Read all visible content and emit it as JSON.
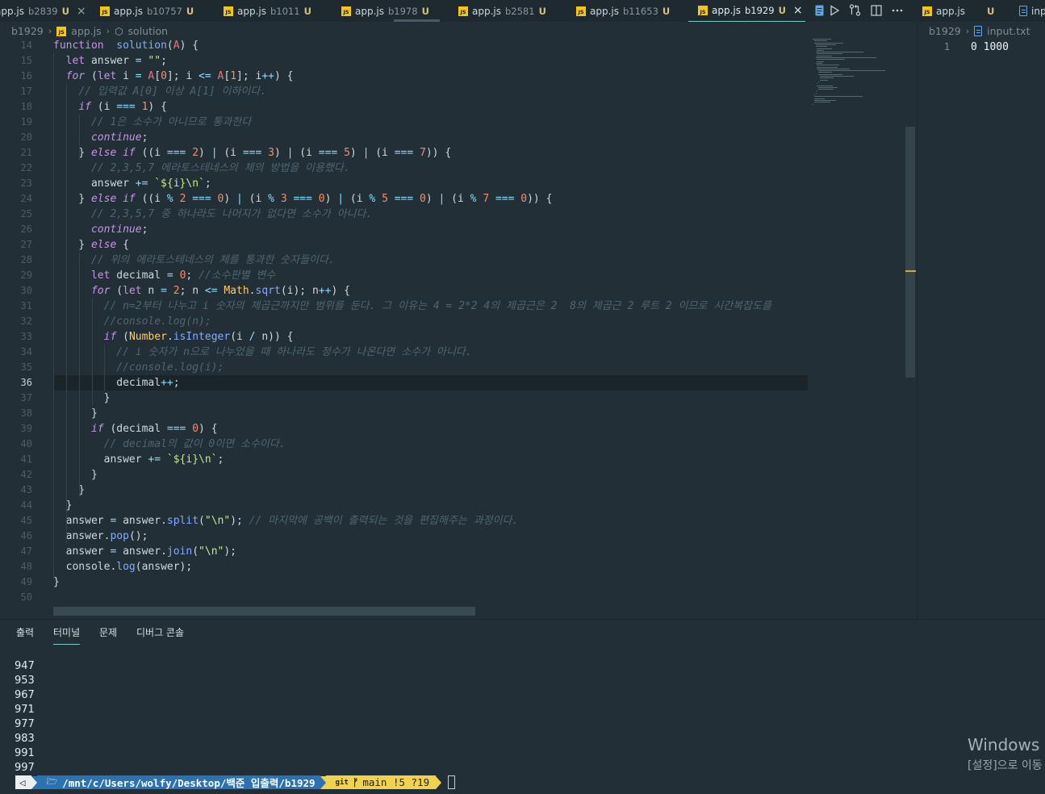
{
  "tabs": [
    {
      "name": "app.js",
      "desc": "b2839",
      "badge": "U",
      "close": "×",
      "active": false
    },
    {
      "name": "app.js",
      "desc": "b10757",
      "badge": "U",
      "active": false
    },
    {
      "name": "app.js",
      "desc": "b1011",
      "badge": "U",
      "active": false
    },
    {
      "name": "app.js",
      "desc": "b1978",
      "badge": "U",
      "active": false
    },
    {
      "name": "app.js",
      "desc": "b2581",
      "badge": "U",
      "active": false
    },
    {
      "name": "app.js",
      "desc": "b11653",
      "badge": "U",
      "active": false
    },
    {
      "name": "app.js",
      "desc": "b1929",
      "badge": "U",
      "close": "×",
      "active": true
    }
  ],
  "right_tabs": [
    {
      "name": "app.js",
      "badge": "U"
    },
    {
      "name": "inp"
    }
  ],
  "toolbar_icons": [
    "open-preview-icon",
    "run-icon",
    "git-compare-icon",
    "split-editor-icon",
    "more-actions-icon"
  ],
  "js_icon_label": "JS",
  "breadcrumb": {
    "folder": "b1929",
    "file": "app.js",
    "symbol": "solution"
  },
  "right_breadcrumb": {
    "folder": "b1929",
    "file": "input.txt"
  },
  "input_file": {
    "line_number": "1",
    "content": "0 1000"
  },
  "editor": {
    "current_line": "36",
    "lines": [
      {
        "n": "14",
        "tokens": [
          [
            "kw",
            "function"
          ],
          [
            "",
            "  "
          ],
          [
            "fn",
            "solution"
          ],
          [
            "",
            "("
          ],
          [
            "par",
            "A"
          ],
          [
            "",
            ") {"
          ]
        ]
      },
      {
        "n": "15",
        "tokens": [
          [
            "",
            "  "
          ],
          [
            "kw",
            "let"
          ],
          [
            "",
            " answer "
          ],
          [
            "op",
            "="
          ],
          [
            "",
            " "
          ],
          [
            "str",
            "\"\""
          ],
          [
            "",
            ";"
          ]
        ]
      },
      {
        "n": "16",
        "tokens": [
          [
            "",
            "  "
          ],
          [
            "kwi",
            "for"
          ],
          [
            "",
            " ("
          ],
          [
            "kw",
            "let"
          ],
          [
            "",
            " i "
          ],
          [
            "op",
            "="
          ],
          [
            "",
            " "
          ],
          [
            "par",
            "A"
          ],
          [
            "",
            "["
          ],
          [
            "num",
            "0"
          ],
          [
            "",
            "]; i "
          ],
          [
            "op",
            "<="
          ],
          [
            "",
            " "
          ],
          [
            "par",
            "A"
          ],
          [
            "",
            "["
          ],
          [
            "num",
            "1"
          ],
          [
            "",
            "]; i"
          ],
          [
            "op",
            "++"
          ],
          [
            "",
            ") {"
          ]
        ]
      },
      {
        "n": "17",
        "tokens": [
          [
            "",
            "    "
          ],
          [
            "cm",
            "// 입력값 A[0] 이상 A[1] 이하이다."
          ]
        ]
      },
      {
        "n": "18",
        "tokens": [
          [
            "",
            "    "
          ],
          [
            "kwi",
            "if"
          ],
          [
            "",
            " (i "
          ],
          [
            "op",
            "==="
          ],
          [
            "",
            " "
          ],
          [
            "num",
            "1"
          ],
          [
            "",
            ") {"
          ]
        ]
      },
      {
        "n": "19",
        "tokens": [
          [
            "",
            "      "
          ],
          [
            "cm",
            "// 1은 소수가 아니므로 통과한다"
          ]
        ]
      },
      {
        "n": "20",
        "tokens": [
          [
            "",
            "      "
          ],
          [
            "kwi",
            "continue"
          ],
          [
            "",
            ";"
          ]
        ]
      },
      {
        "n": "21",
        "tokens": [
          [
            "",
            "    } "
          ],
          [
            "kwi",
            "else if"
          ],
          [
            "",
            " ((i "
          ],
          [
            "op",
            "==="
          ],
          [
            "",
            " "
          ],
          [
            "num",
            "2"
          ],
          [
            "",
            ") "
          ],
          [
            "op",
            "|"
          ],
          [
            "",
            " (i "
          ],
          [
            "op",
            "==="
          ],
          [
            "",
            " "
          ],
          [
            "num",
            "3"
          ],
          [
            "",
            ") "
          ],
          [
            "op",
            "|"
          ],
          [
            "",
            " (i "
          ],
          [
            "op",
            "==="
          ],
          [
            "",
            " "
          ],
          [
            "num",
            "5"
          ],
          [
            "",
            ") "
          ],
          [
            "op",
            "|"
          ],
          [
            "",
            " (i "
          ],
          [
            "op",
            "==="
          ],
          [
            "",
            " "
          ],
          [
            "num",
            "7"
          ],
          [
            "",
            ")) {"
          ]
        ]
      },
      {
        "n": "22",
        "tokens": [
          [
            "",
            "      "
          ],
          [
            "cm",
            "// 2,3,5,7 에라토스테네스의 체의 방법을 이용했다."
          ]
        ]
      },
      {
        "n": "23",
        "tokens": [
          [
            "",
            "      answer "
          ],
          [
            "op",
            "+="
          ],
          [
            "",
            " "
          ],
          [
            "str",
            "`${"
          ],
          [
            "",
            "i"
          ],
          [
            "str",
            "}\\n`"
          ],
          [
            "",
            ";"
          ]
        ]
      },
      {
        "n": "24",
        "tokens": [
          [
            "",
            "    } "
          ],
          [
            "kwi",
            "else if"
          ],
          [
            "",
            " ((i "
          ],
          [
            "op",
            "%"
          ],
          [
            "",
            " "
          ],
          [
            "num",
            "2"
          ],
          [
            "",
            " "
          ],
          [
            "op",
            "==="
          ],
          [
            "",
            " "
          ],
          [
            "num",
            "0"
          ],
          [
            "",
            ") "
          ],
          [
            "op",
            "|"
          ],
          [
            "",
            " (i "
          ],
          [
            "op",
            "%"
          ],
          [
            "",
            " "
          ],
          [
            "num",
            "3"
          ],
          [
            "",
            " "
          ],
          [
            "op",
            "==="
          ],
          [
            "",
            " "
          ],
          [
            "num",
            "0"
          ],
          [
            "",
            ") "
          ],
          [
            "op",
            "|"
          ],
          [
            "",
            " (i "
          ],
          [
            "op",
            "%"
          ],
          [
            "",
            " "
          ],
          [
            "num",
            "5"
          ],
          [
            "",
            " "
          ],
          [
            "op",
            "==="
          ],
          [
            "",
            " "
          ],
          [
            "num",
            "0"
          ],
          [
            "",
            ") "
          ],
          [
            "op",
            "|"
          ],
          [
            "",
            " (i "
          ],
          [
            "op",
            "%"
          ],
          [
            "",
            " "
          ],
          [
            "num",
            "7"
          ],
          [
            "",
            " "
          ],
          [
            "op",
            "==="
          ],
          [
            "",
            " "
          ],
          [
            "num",
            "0"
          ],
          [
            "",
            ")) {"
          ]
        ]
      },
      {
        "n": "25",
        "tokens": [
          [
            "",
            "      "
          ],
          [
            "cm",
            "// 2,3,5,7 중 하나라도 나머지가 없다면 소수가 아니다."
          ]
        ]
      },
      {
        "n": "26",
        "tokens": [
          [
            "",
            "      "
          ],
          [
            "kwi",
            "continue"
          ],
          [
            "",
            ";"
          ]
        ]
      },
      {
        "n": "27",
        "tokens": [
          [
            "",
            "    } "
          ],
          [
            "kwi",
            "else"
          ],
          [
            "",
            " {"
          ]
        ]
      },
      {
        "n": "28",
        "tokens": [
          [
            "",
            "      "
          ],
          [
            "cm",
            "// 위의 에라토스테네스의 체를 통과한 숫자들이다."
          ]
        ]
      },
      {
        "n": "29",
        "tokens": [
          [
            "",
            "      "
          ],
          [
            "kw",
            "let"
          ],
          [
            "",
            " decimal "
          ],
          [
            "op",
            "="
          ],
          [
            "",
            " "
          ],
          [
            "num",
            "0"
          ],
          [
            "",
            "; "
          ],
          [
            "cm",
            "//소수판별 변수"
          ]
        ]
      },
      {
        "n": "30",
        "tokens": [
          [
            "",
            "      "
          ],
          [
            "kwi",
            "for"
          ],
          [
            "",
            " ("
          ],
          [
            "kw",
            "let"
          ],
          [
            "",
            " n "
          ],
          [
            "op",
            "="
          ],
          [
            "",
            " "
          ],
          [
            "num",
            "2"
          ],
          [
            "",
            "; n "
          ],
          [
            "op",
            "<="
          ],
          [
            "",
            " "
          ],
          [
            "cls",
            "Math"
          ],
          [
            "",
            "."
          ],
          [
            "fn",
            "sqrt"
          ],
          [
            "",
            "(i); n"
          ],
          [
            "op",
            "++"
          ],
          [
            "",
            ") {"
          ]
        ]
      },
      {
        "n": "31",
        "tokens": [
          [
            "",
            "        "
          ],
          [
            "cm",
            "// n=2부터 나누고 i 숫자의 제곱근까지만 범위를 둔다. 그 이유는 4 = 2*2 4의 제곱근은 2  8의 제곱근 2 루트 2 이므로 시간복잡도를"
          ]
        ]
      },
      {
        "n": "32",
        "tokens": [
          [
            "",
            "        "
          ],
          [
            "cm",
            "//console.log(n);"
          ]
        ]
      },
      {
        "n": "33",
        "tokens": [
          [
            "",
            "        "
          ],
          [
            "kwi",
            "if"
          ],
          [
            "",
            " ("
          ],
          [
            "cls",
            "Number"
          ],
          [
            "",
            "."
          ],
          [
            "fn",
            "isInteger"
          ],
          [
            "",
            "(i "
          ],
          [
            "op",
            "/"
          ],
          [
            "",
            " n)) {"
          ]
        ]
      },
      {
        "n": "34",
        "tokens": [
          [
            "",
            "          "
          ],
          [
            "cm",
            "// i 숫자가 n으로 나누었을 때 하나라도 정수가 나온다면 소수가 아니다."
          ]
        ]
      },
      {
        "n": "35",
        "tokens": [
          [
            "",
            "          "
          ],
          [
            "cm",
            "//console.log(i);"
          ]
        ]
      },
      {
        "n": "36",
        "tokens": [
          [
            "",
            "          decimal"
          ],
          [
            "op",
            "++"
          ],
          [
            "",
            ";"
          ]
        ]
      },
      {
        "n": "37",
        "tokens": [
          [
            "",
            "        }"
          ]
        ]
      },
      {
        "n": "38",
        "tokens": [
          [
            "",
            "      }"
          ]
        ]
      },
      {
        "n": "39",
        "tokens": [
          [
            "",
            "      "
          ],
          [
            "kwi",
            "if"
          ],
          [
            "",
            " (decimal "
          ],
          [
            "op",
            "==="
          ],
          [
            "",
            " "
          ],
          [
            "num",
            "0"
          ],
          [
            "",
            ") {"
          ]
        ]
      },
      {
        "n": "40",
        "tokens": [
          [
            "",
            "        "
          ],
          [
            "cm",
            "// decimal의 값이 0이면 소수이다."
          ]
        ]
      },
      {
        "n": "41",
        "tokens": [
          [
            "",
            "        answer "
          ],
          [
            "op",
            "+="
          ],
          [
            "",
            " "
          ],
          [
            "str",
            "`${"
          ],
          [
            "",
            "i"
          ],
          [
            "str",
            "}\\n`"
          ],
          [
            "",
            ";"
          ]
        ]
      },
      {
        "n": "42",
        "tokens": [
          [
            "",
            "      }"
          ]
        ]
      },
      {
        "n": "43",
        "tokens": [
          [
            "",
            "    }"
          ]
        ]
      },
      {
        "n": "44",
        "tokens": [
          [
            "",
            "  }"
          ]
        ]
      },
      {
        "n": "45",
        "tokens": [
          [
            "",
            "  answer "
          ],
          [
            "op",
            "="
          ],
          [
            "",
            " answer."
          ],
          [
            "fn",
            "split"
          ],
          [
            "",
            "("
          ],
          [
            "str",
            "\"\\n\""
          ],
          [
            "",
            "); "
          ],
          [
            "cm",
            "// 마지막에 공백이 출력되는 것을 편집해주는 과정이다."
          ]
        ]
      },
      {
        "n": "46",
        "tokens": [
          [
            "",
            "  answer."
          ],
          [
            "fn",
            "pop"
          ],
          [
            "",
            "();"
          ]
        ]
      },
      {
        "n": "47",
        "tokens": [
          [
            "",
            "  answer "
          ],
          [
            "op",
            "="
          ],
          [
            "",
            " answer."
          ],
          [
            "fn",
            "join"
          ],
          [
            "",
            "("
          ],
          [
            "str",
            "\"\\n\""
          ],
          [
            "",
            ");"
          ]
        ]
      },
      {
        "n": "48",
        "tokens": [
          [
            "",
            "  console."
          ],
          [
            "fn",
            "log"
          ],
          [
            "",
            "(answer);"
          ]
        ]
      },
      {
        "n": "49",
        "tokens": [
          [
            "",
            "}"
          ]
        ]
      },
      {
        "n": "50",
        "tokens": []
      }
    ]
  },
  "panel": {
    "tabs": [
      {
        "label": "출력",
        "active": false
      },
      {
        "label": "터미널",
        "active": true
      },
      {
        "label": "문제",
        "active": false
      },
      {
        "label": "디버그 콘솔",
        "active": false
      }
    ],
    "output_lines": [
      "947",
      "953",
      "967",
      "971",
      "977",
      "983",
      "991",
      "997"
    ],
    "prompt": {
      "os_glyph": "◁",
      "folder_glyph": "🗁",
      "path": "/mnt/c/Users/wolfy/Desktop/백준 입출력/b1929",
      "git_label": "git",
      "branch_glyph": "ᚠ",
      "branch": "main !5 ?19"
    }
  },
  "watermark": {
    "line1": "Windows 정",
    "line2": "[설정]으로 이동"
  },
  "colors": {
    "background": "#232f36",
    "accent": "#79cbca",
    "path_segment": "#2b72b3",
    "git_segment": "#f1d24d",
    "keyword": "#c792ea",
    "function": "#82aaff",
    "string": "#c3e88d",
    "number": "#f78c6c",
    "comment": "#4f6570"
  }
}
